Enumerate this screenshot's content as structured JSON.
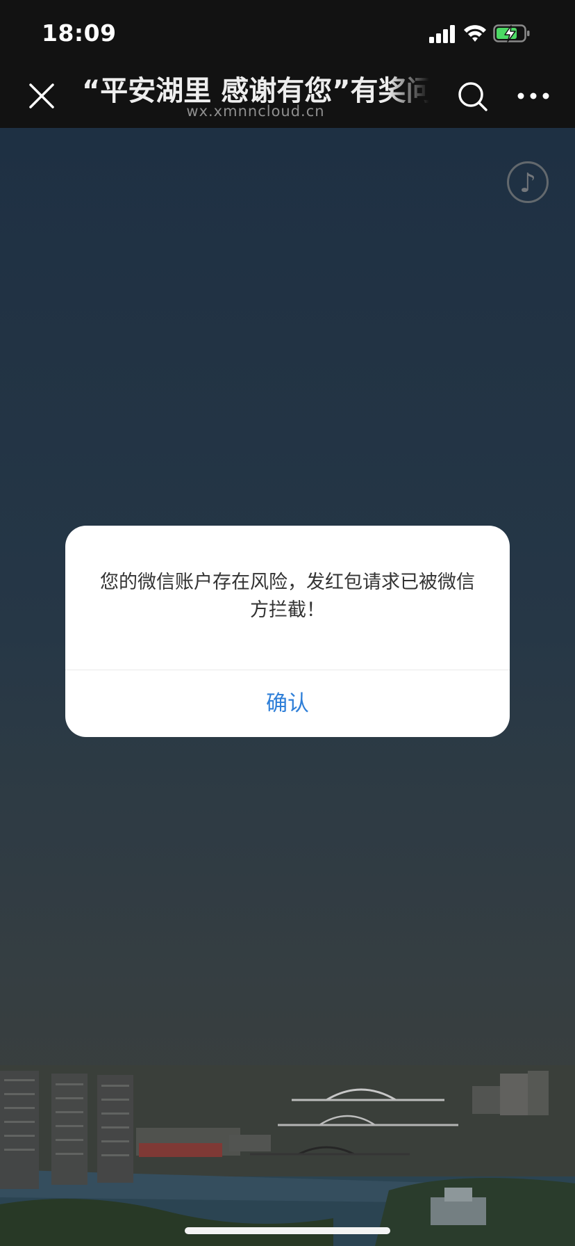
{
  "status_bar": {
    "time": "18:09",
    "icons": [
      "signal-icon",
      "wifi-icon",
      "battery-charging-icon"
    ]
  },
  "nav": {
    "title": "“平安湖里 感谢有您”有奖问",
    "domain": "wx.xmnncloud.cn",
    "close_icon": "close-icon",
    "search_icon": "search-icon",
    "more_icon": "more-icon"
  },
  "content": {
    "music_icon": "music-note-icon",
    "music_glyph": "♪"
  },
  "dialog": {
    "message": "您的微信账户存在风险，发红包请求已被微信方拦截！",
    "confirm_label": "确认"
  },
  "colors": {
    "status_bg": "#121212",
    "accent": "#2f7fd8",
    "battery_charging": "#4cd964"
  }
}
